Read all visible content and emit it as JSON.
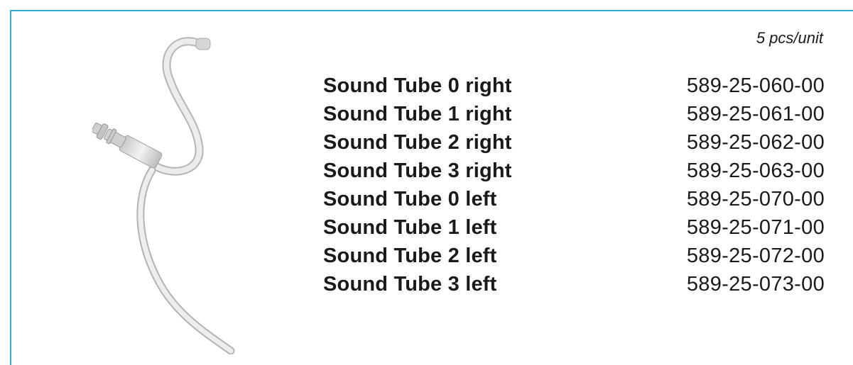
{
  "unit_note": "5 pcs/unit",
  "parts": [
    {
      "name": "Sound Tube 0 right",
      "number": "589-25-060-00"
    },
    {
      "name": "Sound Tube 1 right",
      "number": "589-25-061-00"
    },
    {
      "name": "Sound Tube 2 right",
      "number": "589-25-062-00"
    },
    {
      "name": "Sound Tube 3 right",
      "number": "589-25-063-00"
    },
    {
      "name": "Sound Tube 0 left",
      "number": "589-25-070-00"
    },
    {
      "name": "Sound Tube 1 left",
      "number": "589-25-071-00"
    },
    {
      "name": "Sound Tube 2 left",
      "number": "589-25-072-00"
    },
    {
      "name": "Sound Tube 3 left",
      "number": "589-25-073-00"
    }
  ],
  "colors": {
    "frame_border": "#2fb0d4",
    "tube": "#dcdcdc",
    "text": "#1a1a1a"
  }
}
